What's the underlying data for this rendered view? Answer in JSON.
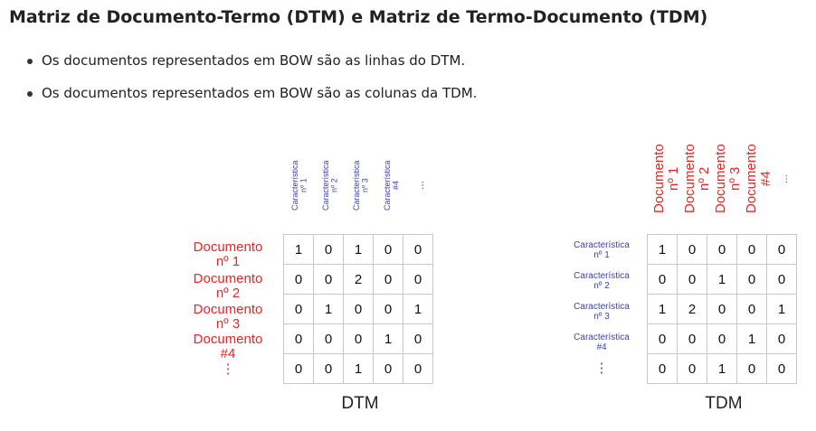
{
  "title": "Matriz de Documento-Termo (DTM) e Matriz de Termo-Documento (TDM)",
  "bullets": [
    "Os documentos representados em BOW são as linhas do DTM.",
    "Os documentos representados em BOW são as colunas da TDM."
  ],
  "dtm": {
    "caption": "DTM",
    "column_headers": [
      "Característica\nnº 1",
      "Característica\nnº 2",
      "Característica\nnº 3",
      "Característica\n#4",
      "..."
    ],
    "row_labels": [
      "Documento\nnº 1",
      "Documento\nnº 2",
      "Documento\nnº 3",
      "Documento\n#4",
      "⋮"
    ],
    "cells": [
      [
        1,
        0,
        1,
        0,
        0
      ],
      [
        0,
        0,
        2,
        0,
        0
      ],
      [
        0,
        1,
        0,
        0,
        1
      ],
      [
        0,
        0,
        0,
        1,
        0
      ],
      [
        0,
        0,
        1,
        0,
        0
      ]
    ]
  },
  "tdm": {
    "caption": "TDM",
    "column_headers": [
      "Documento\nnº 1",
      "Documento\nnº 2",
      "Documento\nnº 3",
      "Documento\n#4",
      "..."
    ],
    "row_labels": [
      "Característica\nnº 1",
      "Característica\nnº 2",
      "Característica\nnº 3",
      "Característica\n#4",
      "⋮"
    ],
    "cells": [
      [
        1,
        0,
        0,
        0,
        0
      ],
      [
        0,
        0,
        1,
        0,
        0
      ],
      [
        1,
        2,
        0,
        0,
        1
      ],
      [
        0,
        0,
        0,
        1,
        0
      ],
      [
        0,
        0,
        1,
        0,
        0
      ]
    ]
  },
  "colors": {
    "feature_label": "#3c3fb0",
    "document_label": "#ee2222",
    "grid_border": "#c8c8c8"
  }
}
